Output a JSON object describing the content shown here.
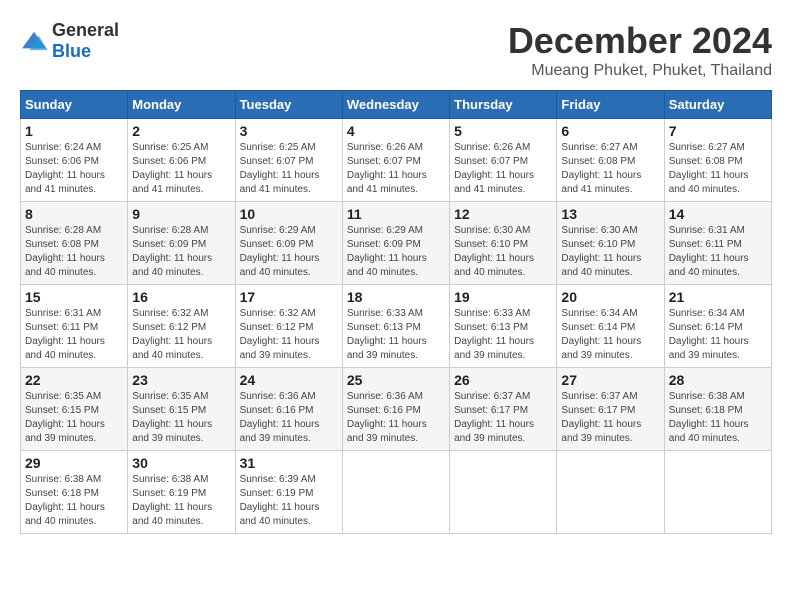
{
  "header": {
    "logo": {
      "general": "General",
      "blue": "Blue"
    },
    "title": "December 2024",
    "subtitle": "Mueang Phuket, Phuket, Thailand"
  },
  "weekdays": [
    "Sunday",
    "Monday",
    "Tuesday",
    "Wednesday",
    "Thursday",
    "Friday",
    "Saturday"
  ],
  "weeks": [
    [
      {
        "day": "1",
        "sunrise": "6:24 AM",
        "sunset": "6:06 PM",
        "daylight": "11 hours and 41 minutes."
      },
      {
        "day": "2",
        "sunrise": "6:25 AM",
        "sunset": "6:06 PM",
        "daylight": "11 hours and 41 minutes."
      },
      {
        "day": "3",
        "sunrise": "6:25 AM",
        "sunset": "6:07 PM",
        "daylight": "11 hours and 41 minutes."
      },
      {
        "day": "4",
        "sunrise": "6:26 AM",
        "sunset": "6:07 PM",
        "daylight": "11 hours and 41 minutes."
      },
      {
        "day": "5",
        "sunrise": "6:26 AM",
        "sunset": "6:07 PM",
        "daylight": "11 hours and 41 minutes."
      },
      {
        "day": "6",
        "sunrise": "6:27 AM",
        "sunset": "6:08 PM",
        "daylight": "11 hours and 41 minutes."
      },
      {
        "day": "7",
        "sunrise": "6:27 AM",
        "sunset": "6:08 PM",
        "daylight": "11 hours and 40 minutes."
      }
    ],
    [
      {
        "day": "8",
        "sunrise": "6:28 AM",
        "sunset": "6:08 PM",
        "daylight": "11 hours and 40 minutes."
      },
      {
        "day": "9",
        "sunrise": "6:28 AM",
        "sunset": "6:09 PM",
        "daylight": "11 hours and 40 minutes."
      },
      {
        "day": "10",
        "sunrise": "6:29 AM",
        "sunset": "6:09 PM",
        "daylight": "11 hours and 40 minutes."
      },
      {
        "day": "11",
        "sunrise": "6:29 AM",
        "sunset": "6:09 PM",
        "daylight": "11 hours and 40 minutes."
      },
      {
        "day": "12",
        "sunrise": "6:30 AM",
        "sunset": "6:10 PM",
        "daylight": "11 hours and 40 minutes."
      },
      {
        "day": "13",
        "sunrise": "6:30 AM",
        "sunset": "6:10 PM",
        "daylight": "11 hours and 40 minutes."
      },
      {
        "day": "14",
        "sunrise": "6:31 AM",
        "sunset": "6:11 PM",
        "daylight": "11 hours and 40 minutes."
      }
    ],
    [
      {
        "day": "15",
        "sunrise": "6:31 AM",
        "sunset": "6:11 PM",
        "daylight": "11 hours and 40 minutes."
      },
      {
        "day": "16",
        "sunrise": "6:32 AM",
        "sunset": "6:12 PM",
        "daylight": "11 hours and 40 minutes."
      },
      {
        "day": "17",
        "sunrise": "6:32 AM",
        "sunset": "6:12 PM",
        "daylight": "11 hours and 39 minutes."
      },
      {
        "day": "18",
        "sunrise": "6:33 AM",
        "sunset": "6:13 PM",
        "daylight": "11 hours and 39 minutes."
      },
      {
        "day": "19",
        "sunrise": "6:33 AM",
        "sunset": "6:13 PM",
        "daylight": "11 hours and 39 minutes."
      },
      {
        "day": "20",
        "sunrise": "6:34 AM",
        "sunset": "6:14 PM",
        "daylight": "11 hours and 39 minutes."
      },
      {
        "day": "21",
        "sunrise": "6:34 AM",
        "sunset": "6:14 PM",
        "daylight": "11 hours and 39 minutes."
      }
    ],
    [
      {
        "day": "22",
        "sunrise": "6:35 AM",
        "sunset": "6:15 PM",
        "daylight": "11 hours and 39 minutes."
      },
      {
        "day": "23",
        "sunrise": "6:35 AM",
        "sunset": "6:15 PM",
        "daylight": "11 hours and 39 minutes."
      },
      {
        "day": "24",
        "sunrise": "6:36 AM",
        "sunset": "6:16 PM",
        "daylight": "11 hours and 39 minutes."
      },
      {
        "day": "25",
        "sunrise": "6:36 AM",
        "sunset": "6:16 PM",
        "daylight": "11 hours and 39 minutes."
      },
      {
        "day": "26",
        "sunrise": "6:37 AM",
        "sunset": "6:17 PM",
        "daylight": "11 hours and 39 minutes."
      },
      {
        "day": "27",
        "sunrise": "6:37 AM",
        "sunset": "6:17 PM",
        "daylight": "11 hours and 39 minutes."
      },
      {
        "day": "28",
        "sunrise": "6:38 AM",
        "sunset": "6:18 PM",
        "daylight": "11 hours and 40 minutes."
      }
    ],
    [
      {
        "day": "29",
        "sunrise": "6:38 AM",
        "sunset": "6:18 PM",
        "daylight": "11 hours and 40 minutes."
      },
      {
        "day": "30",
        "sunrise": "6:38 AM",
        "sunset": "6:19 PM",
        "daylight": "11 hours and 40 minutes."
      },
      {
        "day": "31",
        "sunrise": "6:39 AM",
        "sunset": "6:19 PM",
        "daylight": "11 hours and 40 minutes."
      },
      null,
      null,
      null,
      null
    ]
  ]
}
